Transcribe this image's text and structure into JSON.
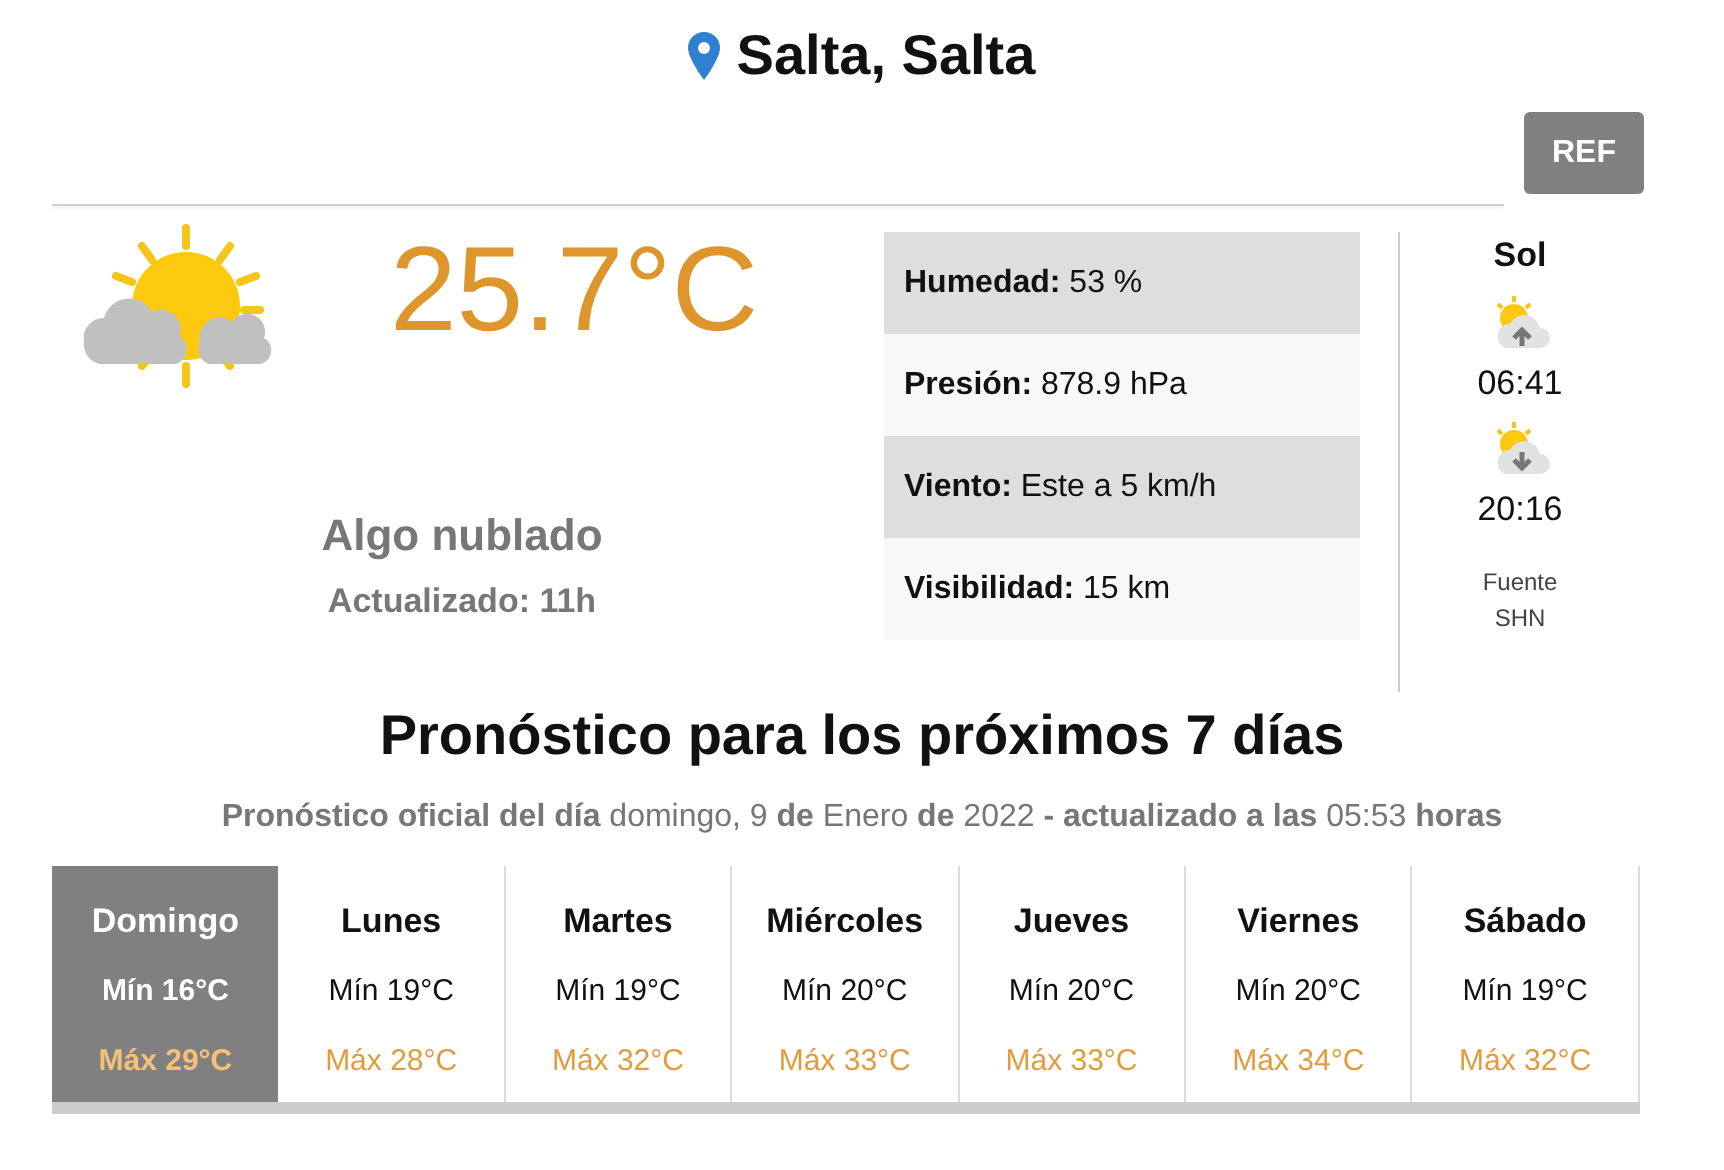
{
  "location": "Salta, Salta",
  "refresh_button": "REF",
  "current": {
    "temperature": "25.7°C",
    "condition": "Algo nublado",
    "updated": "Actualizado: 11h"
  },
  "details": [
    {
      "label": "Humedad:",
      "value": "53 %"
    },
    {
      "label": "Presión:",
      "value": "878.9 hPa"
    },
    {
      "label": "Viento:",
      "value": "Este a 5 km/h"
    },
    {
      "label": "Visibilidad:",
      "value": "15 km"
    }
  ],
  "sun": {
    "title": "Sol",
    "sunrise": "06:41",
    "sunset": "20:16",
    "source": [
      "Fuente",
      "SHN"
    ]
  },
  "forecast": {
    "title": "Pronóstico para los próximos 7 días",
    "subtitle": "**Pronóstico oficial del día** domingo, 9 **de** Enero **de** 2022 **- actualizado a las** 05:53 **horas**",
    "days": [
      {
        "name": "Domingo",
        "min": "Mín 16°C",
        "max": "Máx 29°C",
        "selected": true
      },
      {
        "name": "Lunes",
        "min": "Mín 19°C",
        "max": "Máx 28°C",
        "selected": false
      },
      {
        "name": "Martes",
        "min": "Mín 19°C",
        "max": "Máx 32°C",
        "selected": false
      },
      {
        "name": "Miércoles",
        "min": "Mín 20°C",
        "max": "Máx 33°C",
        "selected": false
      },
      {
        "name": "Jueves",
        "min": "Mín 20°C",
        "max": "Máx 33°C",
        "selected": false
      },
      {
        "name": "Viernes",
        "min": "Mín 20°C",
        "max": "Máx 34°C",
        "selected": false
      },
      {
        "name": "Sábado",
        "min": "Mín 19°C",
        "max": "Máx 32°C",
        "selected": false
      }
    ]
  }
}
